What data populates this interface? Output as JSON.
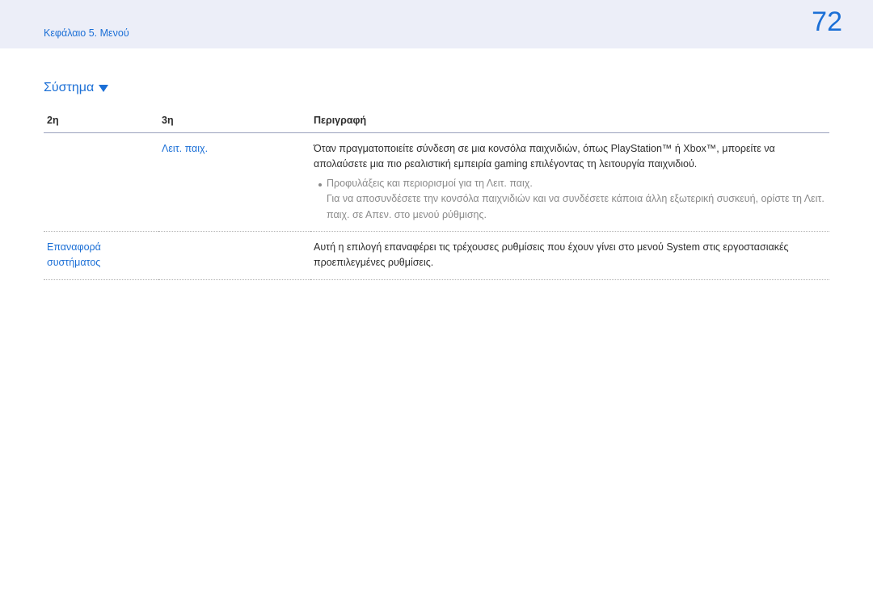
{
  "header": {
    "chapter": "Κεφάλαιο 5. Μενού",
    "page_number": "72"
  },
  "section": {
    "title": "Σύστημα"
  },
  "table": {
    "headers": {
      "col2": "2η",
      "col3": "3η",
      "desc": "Περιγραφή"
    },
    "rows": [
      {
        "col2": "",
        "col3": "Λειτ. παιχ.",
        "desc_main": "Όταν πραγματοποιείτε σύνδεση σε μια κονσόλα παιχνιδιών, όπως PlayStation™ ή Xbox™, μπορείτε να απολαύσετε μια πιο ρεαλιστική εμπειρία gaming επιλέγοντας τη λειτουργία παιχνιδιού.",
        "bullet": "Προφυλάξεις και περιορισμοί για τη Λειτ. παιχ.",
        "sub": "Για να αποσυνδέσετε την κονσόλα παιχνιδιών και να συνδέσετε κάποια άλλη εξωτερική συσκευή, ορίστε τη Λειτ. παιχ. σε Απεν. στο μενού ρύθμισης."
      },
      {
        "col2": "Επαναφορά συστήματος",
        "col3": "",
        "desc_main": "Αυτή η επιλογή επαναφέρει τις τρέχουσες ρυθμίσεις που έχουν γίνει στο μενού System στις εργοστασιακές προεπιλεγμένες ρυθμίσεις."
      }
    ]
  }
}
